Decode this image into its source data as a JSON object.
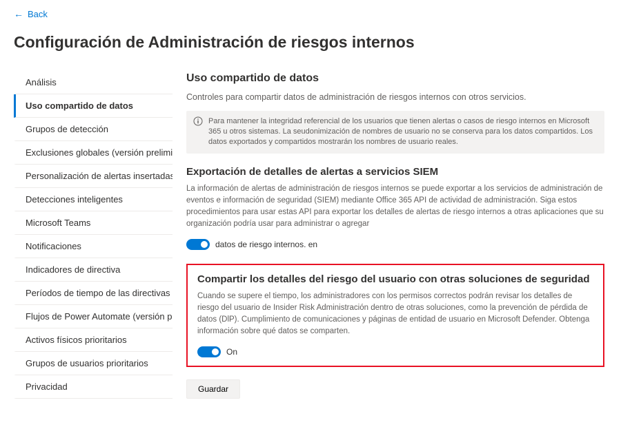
{
  "back": {
    "label": "Back"
  },
  "page": {
    "title": "Configuración de Administración de riesgos internos"
  },
  "sidebar": {
    "items": [
      {
        "label": "Análisis"
      },
      {
        "label": "Uso compartido de datos"
      },
      {
        "label": "Grupos de detección"
      },
      {
        "label": "Exclusiones globales (versión preliminar)"
      },
      {
        "label": "Personalización de alertas insertadas"
      },
      {
        "label": "Detecciones inteligentes"
      },
      {
        "label": "Microsoft Teams"
      },
      {
        "label": "Notificaciones"
      },
      {
        "label": "Indicadores de directiva"
      },
      {
        "label": "Períodos de tiempo de las directivas"
      },
      {
        "label": "Flujos de Power Automate (versión preliminar)"
      },
      {
        "label": "Activos físicos prioritarios"
      },
      {
        "label": "Grupos de usuarios prioritarios"
      },
      {
        "label": "Privacidad"
      }
    ]
  },
  "section1": {
    "title": "Uso compartido de datos",
    "subtitle": "Controles para compartir datos de administración de riesgos internos con otros servicios.",
    "info": "Para mantener la integridad referencial de los usuarios que tienen alertas o casos de riesgo internos en Microsoft 365 u otros sistemas. La seudonimización de nombres de usuario no se conserva para los datos compartidos. Los datos exportados y compartidos mostrarán los nombres de usuario reales."
  },
  "section2": {
    "title": "Exportación de detalles de alertas a servicios SIEM",
    "body": "La información de alertas de administración de riesgos internos se puede exportar a los servicios de administración de eventos e información de seguridad (SIEM) mediante Office 365 API de actividad de administración. Siga estos procedimientos para usar estas API para exportar los detalles de alertas de riesgo internos a otras aplicaciones que su organización podría usar para administrar o agregar",
    "toggle_label": "datos de riesgo internos. en"
  },
  "section3": {
    "title": "Compartir los detalles del riesgo del usuario con otras soluciones de seguridad",
    "body": "Cuando se supere el tiempo, los administradores con los permisos correctos podrán revisar los detalles de riesgo del usuario de Insider Risk Administración dentro de otras soluciones, como la prevención de pérdida de datos (DlP). Cumplimiento de comunicaciones y páginas de entidad de usuario en Microsoft Defender. Obtenga información sobre qué datos se comparten.",
    "toggle_label": "On"
  },
  "actions": {
    "save": "Guardar"
  }
}
